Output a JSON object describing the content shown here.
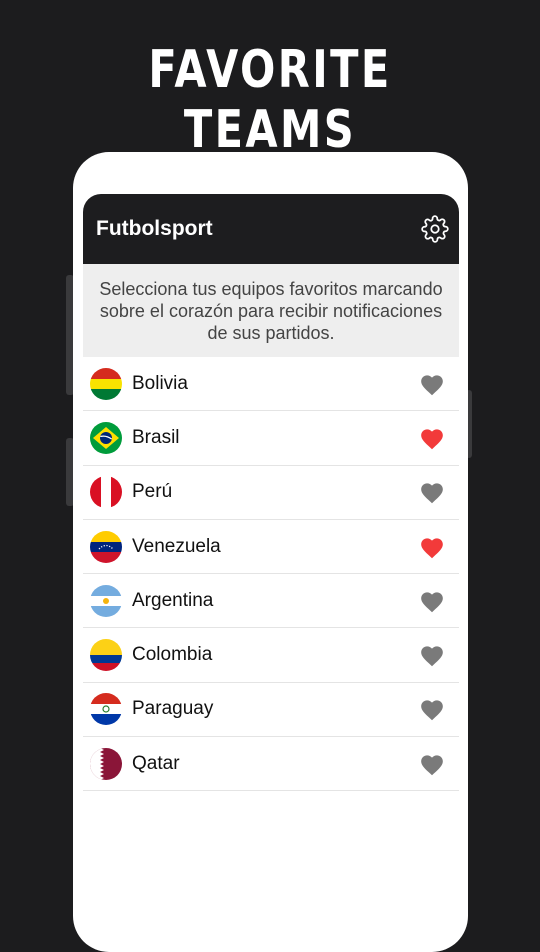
{
  "promo": {
    "title": "FAVORITE TEAMS"
  },
  "appbar": {
    "title": "Futbolsport",
    "settings_icon": "gear-icon"
  },
  "instructions": "Selecciona tus equipos favoritos marcando sobre el corazón para recibir notificaciones de sus partidos.",
  "colors": {
    "heart_on": "#f23a3a",
    "heart_off": "#7a7a7a",
    "appbar": "#1d1d1f"
  },
  "teams": [
    {
      "name": "Bolivia",
      "flag": "bolivia-flag",
      "favorite": false
    },
    {
      "name": "Brasil",
      "flag": "brazil-flag",
      "favorite": true
    },
    {
      "name": "Perú",
      "flag": "peru-flag",
      "favorite": false
    },
    {
      "name": "Venezuela",
      "flag": "venezuela-flag",
      "favorite": true
    },
    {
      "name": "Argentina",
      "flag": "argentina-flag",
      "favorite": false
    },
    {
      "name": "Colombia",
      "flag": "colombia-flag",
      "favorite": false
    },
    {
      "name": "Paraguay",
      "flag": "paraguay-flag",
      "favorite": false
    },
    {
      "name": "Qatar",
      "flag": "qatar-flag",
      "favorite": false
    }
  ]
}
